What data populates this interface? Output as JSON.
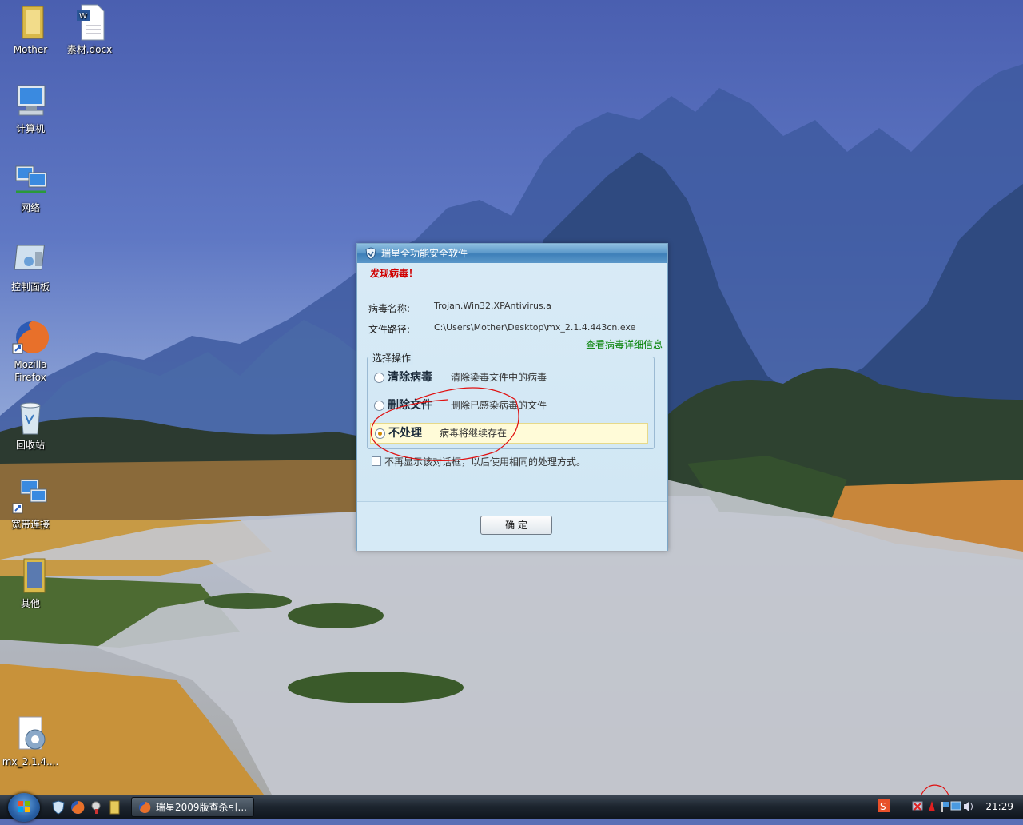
{
  "desktop": {
    "icons": [
      {
        "label": "Mother",
        "kind": "folder-icon"
      },
      {
        "label": "素材.docx",
        "kind": "word-document-icon"
      },
      {
        "label": "计算机",
        "kind": "computer-icon"
      },
      {
        "label": "网络",
        "kind": "network-icon"
      },
      {
        "label": "控制面板",
        "kind": "control-panel-icon"
      },
      {
        "label": "Mozilla Firefox",
        "kind": "firefox-icon"
      },
      {
        "label": "回收站",
        "kind": "recycle-bin-icon"
      },
      {
        "label": "宽带连接",
        "kind": "broadband-connection-icon"
      },
      {
        "label": "其他",
        "kind": "folder-icon"
      },
      {
        "label": "mx_2.1.4....",
        "kind": "installer-icon"
      }
    ]
  },
  "dialog": {
    "title": "瑞星全功能安全软件",
    "alert": "发现病毒！",
    "virus_name_label": "病毒名称:",
    "virus_name": "Trojan.Win32.XPAntivirus.a",
    "file_path_label": "文件路径:",
    "file_path": "C:\\Users\\Mother\\Desktop\\mx_2.1.4.443cn.exe",
    "details_link": "查看病毒详细信息",
    "group_title": "选择操作",
    "options": [
      {
        "main": "清除病毒",
        "desc": "清除染毒文件中的病毒",
        "selected": false
      },
      {
        "main": "删除文件",
        "desc": "删除已感染病毒的文件",
        "selected": false
      },
      {
        "main": "不处理",
        "desc": "病毒将继续存在",
        "selected": true
      }
    ],
    "remember_text": "不再显示该对话框，以后使用相同的处理方式。",
    "remember_checked": false,
    "ok_label": "确 定"
  },
  "taskbar": {
    "task_button_label": "瑞星2009版查杀引...",
    "clock": "21:29"
  },
  "colors": {
    "alert_red": "#d00000",
    "link_green": "#008000",
    "selected_option_bg": "#fffbd8",
    "dialog_titlebar": "#3d7fb8"
  }
}
